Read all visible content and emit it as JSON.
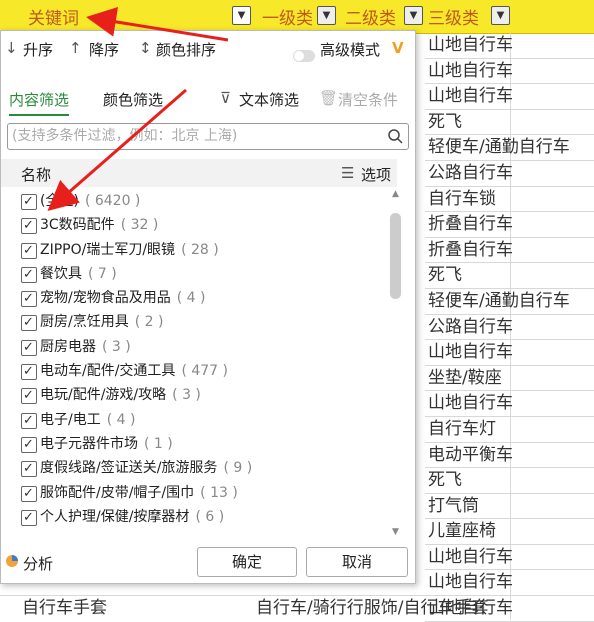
{
  "header": {
    "col1": "关键词",
    "col2": "一级类",
    "col3": "二级类",
    "col4": "三级类"
  },
  "sheet_rows": [
    "山地自行车",
    "山地自行车",
    "山地自行车",
    "死飞",
    "轻便车/通勤自行车",
    "公路自行车",
    "自行车锁",
    "折叠自行车",
    "折叠自行车",
    "死飞",
    "轻便车/通勤自行车",
    "公路自行车",
    "山地自行车",
    "坐垫/鞍座",
    "山地自行车",
    "自行车灯",
    "电动平衡车",
    "死飞",
    "打气筒",
    "儿童座椅",
    "山地自行车",
    "山地自行车",
    "山地自行车"
  ],
  "bottom_row": {
    "col1": "自行车手套",
    "col2": "自行车/骑行行服饰/自行车手套"
  },
  "sortbar": {
    "asc": "升序",
    "desc": "降序",
    "color": "颜色排序",
    "advanced": "高级模式"
  },
  "tabs": {
    "content": "内容筛选",
    "color": "颜色筛选",
    "text": "文本筛选",
    "clear": "清空条件"
  },
  "search": {
    "placeholder": "(支持多条件过滤，例如：北京 上海)"
  },
  "list_head": {
    "name": "名称",
    "options": "选项"
  },
  "items": [
    {
      "label": "(全选)",
      "count": "( 6420 )"
    },
    {
      "label": "3C数码配件",
      "count": "( 32 )"
    },
    {
      "label": "ZIPPO/瑞士军刀/眼镜",
      "count": "( 28 )"
    },
    {
      "label": "餐饮具",
      "count": "( 7 )"
    },
    {
      "label": "宠物/宠物食品及用品",
      "count": "( 4 )"
    },
    {
      "label": "厨房/烹饪用具",
      "count": "( 2 )"
    },
    {
      "label": "厨房电器",
      "count": "( 3 )"
    },
    {
      "label": "电动车/配件/交通工具",
      "count": "( 477 )"
    },
    {
      "label": "电玩/配件/游戏/攻略",
      "count": "( 3 )"
    },
    {
      "label": "电子/电工",
      "count": "( 4 )"
    },
    {
      "label": "电子元器件市场",
      "count": "( 1 )"
    },
    {
      "label": "度假线路/签证送关/旅游服务",
      "count": "( 9 )"
    },
    {
      "label": "服饰配件/皮带/帽子/围巾",
      "count": "( 13 )"
    },
    {
      "label": "个人护理/保健/按摩器材",
      "count": "( 6 )"
    }
  ],
  "footer": {
    "analyze": "分析",
    "ok": "确定",
    "cancel": "取消"
  },
  "colors": {
    "header_bg": "#f7e82a",
    "accent_green": "#2a8a3a",
    "arrow_red": "#e8201c",
    "advanced_v": "#f0a020"
  }
}
